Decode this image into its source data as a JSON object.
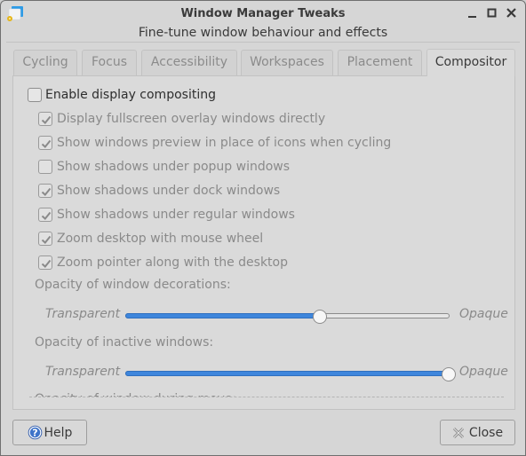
{
  "window": {
    "title": "Window Manager Tweaks",
    "subtitle": "Fine-tune window behaviour and effects",
    "controls": [
      "minimize",
      "maximize",
      "close"
    ]
  },
  "tabs": [
    {
      "label": "Cycling",
      "active": false
    },
    {
      "label": "Focus",
      "active": false
    },
    {
      "label": "Accessibility",
      "active": false
    },
    {
      "label": "Workspaces",
      "active": false
    },
    {
      "label": "Placement",
      "active": false
    },
    {
      "label": "Compositor",
      "active": true
    }
  ],
  "compositor": {
    "enable": {
      "label": "Enable display compositing",
      "checked": false
    },
    "options": [
      {
        "label": "Display fullscreen overlay windows directly",
        "checked": true
      },
      {
        "label": "Show windows preview in place of icons when cycling",
        "checked": true
      },
      {
        "label": "Show shadows under popup windows",
        "checked": false
      },
      {
        "label": "Show shadows under dock windows",
        "checked": true
      },
      {
        "label": "Show shadows under regular windows",
        "checked": true
      },
      {
        "label": "Zoom desktop with mouse wheel",
        "checked": true
      },
      {
        "label": "Zoom pointer along with the desktop",
        "checked": true
      }
    ],
    "sliders": [
      {
        "label": "Opacity of window decorations:",
        "min_label": "Transparent",
        "max_label": "Opaque",
        "value_fraction": 0.6
      },
      {
        "label": "Opacity of inactive windows:",
        "min_label": "Transparent",
        "max_label": "Opaque",
        "value_fraction": 1.0
      }
    ],
    "cut_off_label": "Opacity of window during move:"
  },
  "buttons": {
    "help": {
      "label": "Help",
      "icon": "help-icon"
    },
    "close": {
      "label": "Close",
      "icon": "close-icon"
    }
  },
  "colors": {
    "accent": "#3e86dc",
    "window_bg": "#d6d6d6",
    "text": "#3a3a3a",
    "disabled_text": "#8a8a8a"
  }
}
